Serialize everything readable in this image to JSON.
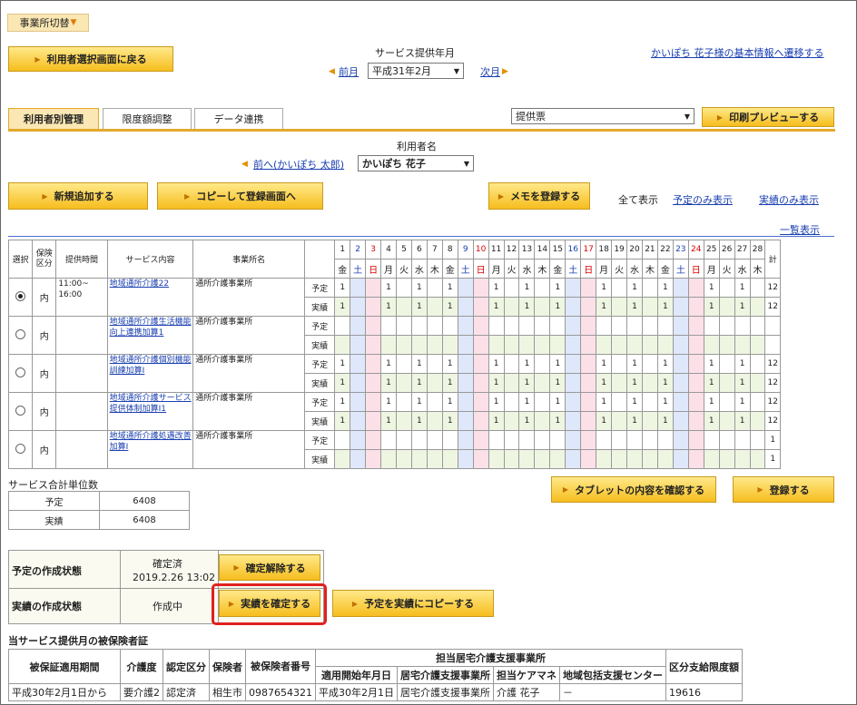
{
  "office_switch": "事業所切替",
  "back_button": "利用者選択画面に戻る",
  "service_month_label": "サービス提供年月",
  "prev_month": "前月",
  "month_value": "平成31年2月",
  "next_month": "次月",
  "user_info_link": "かいぽち 花子様の基本情報へ遷移する",
  "tabs": [
    "利用者別管理",
    "限度額調整",
    "データ連携"
  ],
  "print_select": "提供票",
  "print_preview": "印刷プレビューする",
  "user_name_label": "利用者名",
  "prev_user": "前へ(かいぽち 太郎)",
  "user_select": "かいぽち 花子",
  "new_button": "新規追加する",
  "copy_button": "コピーして登録画面へ",
  "memo_button": "メモを登録する",
  "filter": {
    "all": "全て表示",
    "plan": "予定のみ表示",
    "actual": "実績のみ表示"
  },
  "list_view": "一覧表示",
  "grid": {
    "headers": {
      "select": "選択",
      "insurance": "保険区分",
      "time": "提供時間",
      "service": "サービス内容",
      "office": "事業所名",
      "total": "計"
    },
    "days": [
      "1",
      "2",
      "3",
      "4",
      "5",
      "6",
      "7",
      "8",
      "9",
      "10",
      "11",
      "12",
      "13",
      "14",
      "15",
      "16",
      "17",
      "18",
      "19",
      "20",
      "21",
      "22",
      "23",
      "24",
      "25",
      "26",
      "27",
      "28"
    ],
    "weekdays": [
      "金",
      "土",
      "日",
      "月",
      "火",
      "水",
      "木",
      "金",
      "土",
      "日",
      "月",
      "火",
      "水",
      "木",
      "金",
      "土",
      "日",
      "月",
      "火",
      "水",
      "木",
      "金",
      "土",
      "日",
      "月",
      "火",
      "水",
      "木"
    ],
    "plan_label": "予定",
    "actual_label": "実績",
    "rows": [
      {
        "insurance": "内",
        "time": "11:00~\n16:00",
        "service": "地域通所介護22",
        "office": "通所介護事業所",
        "plan": [
          "1",
          "",
          "",
          "1",
          "",
          "1",
          "",
          "1",
          "",
          "",
          "1",
          "",
          "1",
          "",
          "1",
          "",
          "",
          "1",
          "",
          "1",
          "",
          "1",
          "",
          "",
          "1",
          "",
          "1",
          ""
        ],
        "actual": [
          "1",
          "",
          "",
          "1",
          "",
          "1",
          "",
          "1",
          "",
          "",
          "1",
          "",
          "1",
          "",
          "1",
          "",
          "",
          "1",
          "",
          "1",
          "",
          "1",
          "",
          "",
          "1",
          "",
          "1",
          ""
        ],
        "plan_total": "12",
        "actual_total": "12",
        "selected": true
      },
      {
        "insurance": "内",
        "time": "",
        "service": "地域通所介護生活機能向上連携加算1",
        "office": "通所介護事業所",
        "plan": [
          "",
          "",
          "",
          "",
          "",
          "",
          "",
          "",
          "",
          "",
          "",
          "",
          "",
          "",
          "",
          "",
          "",
          "",
          "",
          "",
          "",
          "",
          "",
          "",
          "",
          "",
          "",
          ""
        ],
        "actual": [
          "",
          "",
          "",
          "",
          "",
          "",
          "",
          "",
          "",
          "",
          "",
          "",
          "",
          "",
          "",
          "",
          "",
          "",
          "",
          "",
          "",
          "",
          "",
          "",
          "",
          "",
          "",
          ""
        ],
        "plan_total": "",
        "actual_total": "",
        "selected": false
      },
      {
        "insurance": "内",
        "time": "",
        "service": "地域通所介護個別機能訓練加算Ⅰ",
        "office": "通所介護事業所",
        "plan": [
          "1",
          "",
          "",
          "1",
          "",
          "1",
          "",
          "1",
          "",
          "",
          "1",
          "",
          "1",
          "",
          "1",
          "",
          "",
          "1",
          "",
          "1",
          "",
          "1",
          "",
          "",
          "1",
          "",
          "1",
          ""
        ],
        "actual": [
          "1",
          "",
          "",
          "1",
          "",
          "1",
          "",
          "1",
          "",
          "",
          "1",
          "",
          "1",
          "",
          "1",
          "",
          "",
          "1",
          "",
          "1",
          "",
          "1",
          "",
          "",
          "1",
          "",
          "1",
          ""
        ],
        "plan_total": "12",
        "actual_total": "12",
        "selected": false
      },
      {
        "insurance": "内",
        "time": "",
        "service": "地域通所介護サービス提供体制加算Ⅰ1",
        "office": "通所介護事業所",
        "plan": [
          "1",
          "",
          "",
          "1",
          "",
          "1",
          "",
          "1",
          "",
          "",
          "1",
          "",
          "1",
          "",
          "1",
          "",
          "",
          "1",
          "",
          "1",
          "",
          "1",
          "",
          "",
          "1",
          "",
          "1",
          ""
        ],
        "actual": [
          "1",
          "",
          "",
          "1",
          "",
          "1",
          "",
          "1",
          "",
          "",
          "1",
          "",
          "1",
          "",
          "1",
          "",
          "",
          "1",
          "",
          "1",
          "",
          "1",
          "",
          "",
          "1",
          "",
          "1",
          ""
        ],
        "plan_total": "12",
        "actual_total": "12",
        "selected": false
      },
      {
        "insurance": "内",
        "time": "",
        "service": "地域通所介護処遇改善加算Ⅰ",
        "office": "通所介護事業所",
        "plan": [
          "",
          "",
          "",
          "",
          "",
          "",
          "",
          "",
          "",
          "",
          "",
          "",
          "",
          "",
          "",
          "",
          "",
          "",
          "",
          "",
          "",
          "",
          "",
          "",
          "",
          "",
          "",
          ""
        ],
        "actual": [
          "",
          "",
          "",
          "",
          "",
          "",
          "",
          "",
          "",
          "",
          "",
          "",
          "",
          "",
          "",
          "",
          "",
          "",
          "",
          "",
          "",
          "",
          "",
          "",
          "",
          "",
          "",
          ""
        ],
        "plan_total": "1",
        "actual_total": "1",
        "selected": false
      }
    ]
  },
  "units": {
    "title": "サービス合計単位数",
    "plan_label": "予定",
    "plan_value": "6408",
    "actual_label": "実績",
    "actual_value": "6408"
  },
  "tablet_button": "タブレットの内容を確認する",
  "register_button": "登録する",
  "status": {
    "plan_label": "予定の作成状態",
    "plan_state": "確定済",
    "plan_date": "2019.2.26 13:02",
    "unconfirm_button": "確定解除する",
    "actual_label": "実績の作成状態",
    "actual_state": "作成中",
    "confirm_button": "実績を確定する",
    "copy_plan_button": "予定を実績にコピーする"
  },
  "insured_title": "当サービス提供月の被保険者証",
  "insured": {
    "h_period": "被保証適用期間",
    "h_care": "介護度",
    "h_cert": "認定区分",
    "h_insurer": "保険者",
    "h_number": "被保険者番号",
    "h_office_group": "担当居宅介護支援事業所",
    "h_start": "適用開始年月日",
    "h_office": "居宅介護支援事業所",
    "h_manager": "担当ケアマネ",
    "h_center": "地域包括支援センター",
    "h_limit": "区分支給限度額",
    "row": {
      "period": "平成30年2月1日から",
      "care": "要介護2",
      "cert": "認定済",
      "insurer": "相生市",
      "number": "0987654321",
      "start": "平成30年2月1日",
      "office": "居宅介護支援事業所",
      "manager": "介護 花子",
      "center": "－",
      "limit": "19616"
    }
  }
}
